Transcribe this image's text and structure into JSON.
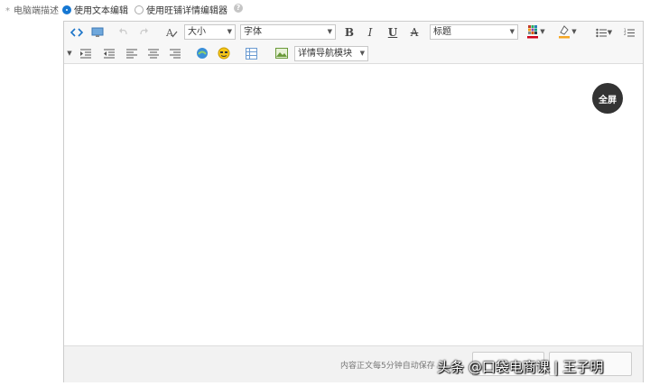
{
  "description_row": {
    "label": "电脑端描述",
    "options": [
      {
        "label": "使用文本编辑",
        "selected": true
      },
      {
        "label": "使用旺铺详情编辑器",
        "selected": false
      }
    ],
    "help_icon": "question-icon"
  },
  "toolbar": {
    "font_size_select": "大小",
    "font_family_select": "字体",
    "heading_select": "标题",
    "bold": "B",
    "italic": "I",
    "underline": "U",
    "strikethrough": "A",
    "detail_nav_module": "详情导航模块",
    "text_color": "#d0021b",
    "highlight_color": "#f5a623"
  },
  "editor": {
    "fullscreen_label": "全屏"
  },
  "footer": {
    "autosave_status": "内容正文每5分钟自动保存"
  },
  "watermark": "头条 @口袋电商课 | 王子明"
}
